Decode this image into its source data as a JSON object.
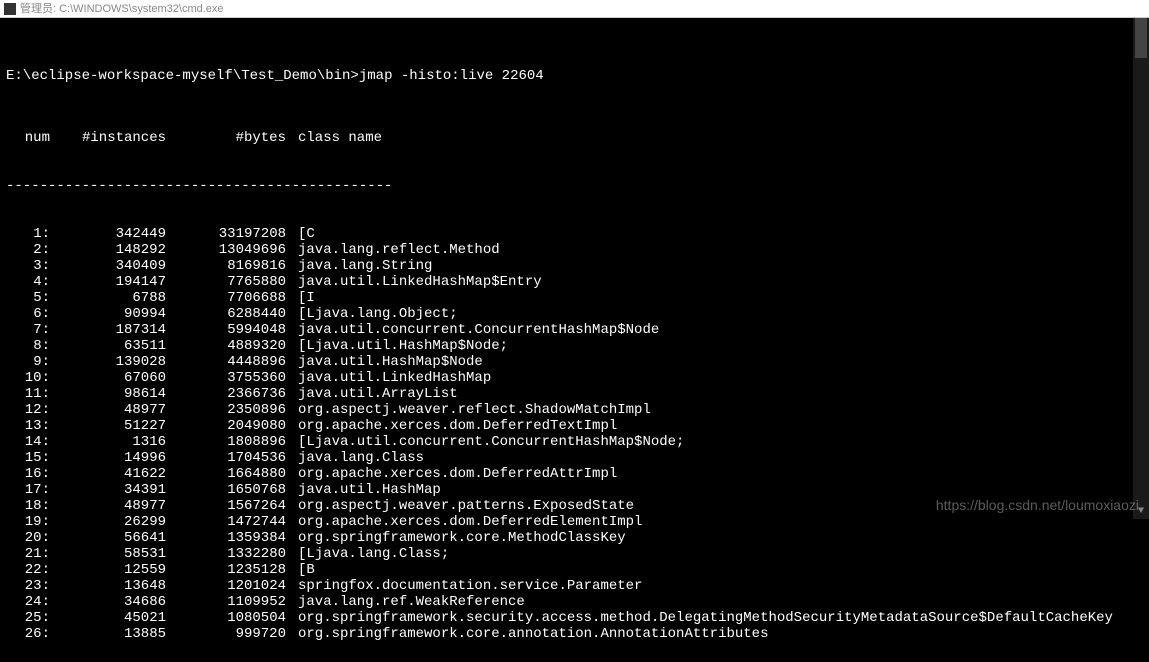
{
  "titlebar": {
    "label": "管理员: C:\\WINDOWS\\system32\\cmd.exe"
  },
  "prompt": {
    "path": "E:\\eclipse-workspace-myself\\Test_Demo\\bin>",
    "command": "jmap -histo:live 22604"
  },
  "header": {
    "num": "num",
    "instances": "#instances",
    "bytes": "#bytes",
    "classname": "class name"
  },
  "divider": "----------------------------------------------",
  "rows": [
    {
      "num": "1:",
      "instances": "342449",
      "bytes": "33197208",
      "cls": "[C"
    },
    {
      "num": "2:",
      "instances": "148292",
      "bytes": "13049696",
      "cls": "java.lang.reflect.Method"
    },
    {
      "num": "3:",
      "instances": "340409",
      "bytes": "8169816",
      "cls": "java.lang.String"
    },
    {
      "num": "4:",
      "instances": "194147",
      "bytes": "7765880",
      "cls": "java.util.LinkedHashMap$Entry"
    },
    {
      "num": "5:",
      "instances": "6788",
      "bytes": "7706688",
      "cls": "[I"
    },
    {
      "num": "6:",
      "instances": "90994",
      "bytes": "6288440",
      "cls": "[Ljava.lang.Object;"
    },
    {
      "num": "7:",
      "instances": "187314",
      "bytes": "5994048",
      "cls": "java.util.concurrent.ConcurrentHashMap$Node"
    },
    {
      "num": "8:",
      "instances": "63511",
      "bytes": "4889320",
      "cls": "[Ljava.util.HashMap$Node;"
    },
    {
      "num": "9:",
      "instances": "139028",
      "bytes": "4448896",
      "cls": "java.util.HashMap$Node"
    },
    {
      "num": "10:",
      "instances": "67060",
      "bytes": "3755360",
      "cls": "java.util.LinkedHashMap"
    },
    {
      "num": "11:",
      "instances": "98614",
      "bytes": "2366736",
      "cls": "java.util.ArrayList"
    },
    {
      "num": "12:",
      "instances": "48977",
      "bytes": "2350896",
      "cls": "org.aspectj.weaver.reflect.ShadowMatchImpl"
    },
    {
      "num": "13:",
      "instances": "51227",
      "bytes": "2049080",
      "cls": "org.apache.xerces.dom.DeferredTextImpl"
    },
    {
      "num": "14:",
      "instances": "1316",
      "bytes": "1808896",
      "cls": "[Ljava.util.concurrent.ConcurrentHashMap$Node;"
    },
    {
      "num": "15:",
      "instances": "14996",
      "bytes": "1704536",
      "cls": "java.lang.Class"
    },
    {
      "num": "16:",
      "instances": "41622",
      "bytes": "1664880",
      "cls": "org.apache.xerces.dom.DeferredAttrImpl"
    },
    {
      "num": "17:",
      "instances": "34391",
      "bytes": "1650768",
      "cls": "java.util.HashMap"
    },
    {
      "num": "18:",
      "instances": "48977",
      "bytes": "1567264",
      "cls": "org.aspectj.weaver.patterns.ExposedState"
    },
    {
      "num": "19:",
      "instances": "26299",
      "bytes": "1472744",
      "cls": "org.apache.xerces.dom.DeferredElementImpl"
    },
    {
      "num": "20:",
      "instances": "56641",
      "bytes": "1359384",
      "cls": "org.springframework.core.MethodClassKey"
    },
    {
      "num": "21:",
      "instances": "58531",
      "bytes": "1332280",
      "cls": "[Ljava.lang.Class;"
    },
    {
      "num": "22:",
      "instances": "12559",
      "bytes": "1235128",
      "cls": "[B"
    },
    {
      "num": "23:",
      "instances": "13648",
      "bytes": "1201024",
      "cls": "springfox.documentation.service.Parameter"
    },
    {
      "num": "24:",
      "instances": "34686",
      "bytes": "1109952",
      "cls": "java.lang.ref.WeakReference"
    },
    {
      "num": "25:",
      "instances": "45021",
      "bytes": "1080504",
      "cls": "org.springframework.security.access.method.DelegatingMethodSecurityMetadataSource$DefaultCacheKey"
    },
    {
      "num": "26:",
      "instances": "13885",
      "bytes": "999720",
      "cls": "org.springframework.core.annotation.AnnotationAttributes"
    }
  ],
  "watermark": "https://blog.csdn.net/loumoxiaozi"
}
